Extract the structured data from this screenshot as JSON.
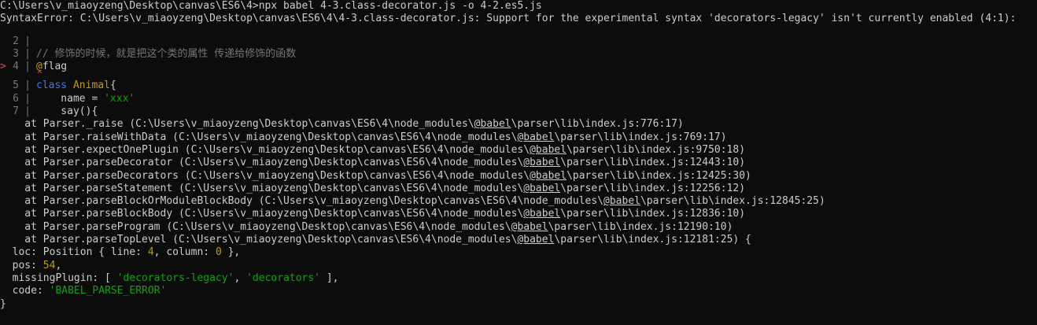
{
  "terminal": {
    "command_line": "C:\\Users\\v_miaoyzeng\\Desktop\\canvas\\ES6\\4>npx babel 4-3.class-decorator.js -o 4-2.es5.js",
    "error_line": "SyntaxError: C:\\Users\\v_miaoyzeng\\Desktop\\canvas\\ES6\\4\\4-3.class-decorator.js: Support for the experimental syntax 'decorators-legacy' isn't currently enabled (4:1):",
    "code_frame": [
      {
        "marker": "",
        "num": "2",
        "content": ""
      },
      {
        "marker": "",
        "num": "3",
        "content": "// 修饰的时候，就是把这个类的属性 传递给修饰的函数"
      },
      {
        "marker": ">",
        "num": "4",
        "content": "@flag"
      },
      {
        "marker": "",
        "num": "5",
        "content": "class Animal{"
      },
      {
        "marker": "",
        "num": "6",
        "content": "    name = 'xxx'"
      },
      {
        "marker": "",
        "num": "7",
        "content": "    say(){"
      }
    ],
    "caret_symbol": "^",
    "stack": [
      {
        "prefix": "    at Parser._raise (C:\\Users\\v_miaoyzeng\\Desktop\\canvas\\ES6\\4\\node_modules\\",
        "link": "@babel",
        "suffix": "\\parser\\lib\\index.js:776:17)"
      },
      {
        "prefix": "    at Parser.raiseWithData (C:\\Users\\v_miaoyzeng\\Desktop\\canvas\\ES6\\4\\node_modules\\",
        "link": "@babel",
        "suffix": "\\parser\\lib\\index.js:769:17)"
      },
      {
        "prefix": "    at Parser.expectOnePlugin (C:\\Users\\v_miaoyzeng\\Desktop\\canvas\\ES6\\4\\node_modules\\",
        "link": "@babel",
        "suffix": "\\parser\\lib\\index.js:9750:18)"
      },
      {
        "prefix": "    at Parser.parseDecorator (C:\\Users\\v_miaoyzeng\\Desktop\\canvas\\ES6\\4\\node_modules\\",
        "link": "@babel",
        "suffix": "\\parser\\lib\\index.js:12443:10)"
      },
      {
        "prefix": "    at Parser.parseDecorators (C:\\Users\\v_miaoyzeng\\Desktop\\canvas\\ES6\\4\\node_modules\\",
        "link": "@babel",
        "suffix": "\\parser\\lib\\index.js:12425:30)"
      },
      {
        "prefix": "    at Parser.parseStatement (C:\\Users\\v_miaoyzeng\\Desktop\\canvas\\ES6\\4\\node_modules\\",
        "link": "@babel",
        "suffix": "\\parser\\lib\\index.js:12256:12)"
      },
      {
        "prefix": "    at Parser.parseBlockOrModuleBlockBody (C:\\Users\\v_miaoyzeng\\Desktop\\canvas\\ES6\\4\\node_modules\\",
        "link": "@babel",
        "suffix": "\\parser\\lib\\index.js:12845:25)"
      },
      {
        "prefix": "    at Parser.parseBlockBody (C:\\Users\\v_miaoyzeng\\Desktop\\canvas\\ES6\\4\\node_modules\\",
        "link": "@babel",
        "suffix": "\\parser\\lib\\index.js:12836:10)"
      },
      {
        "prefix": "    at Parser.parseProgram (C:\\Users\\v_miaoyzeng\\Desktop\\canvas\\ES6\\4\\node_modules\\",
        "link": "@babel",
        "suffix": "\\parser\\lib\\index.js:12190:10)"
      },
      {
        "prefix": "    at Parser.parseTopLevel (C:\\Users\\v_miaoyzeng\\Desktop\\canvas\\ES6\\4\\node_modules\\",
        "link": "@babel",
        "suffix": "\\parser\\lib\\index.js:12181:25) {"
      }
    ],
    "loc_label": "  loc: Position { line: ",
    "loc_line": "4",
    "loc_mid": ", column: ",
    "loc_column": "0",
    "loc_end": " },",
    "pos_label": "  pos: ",
    "pos_value": "54",
    "pos_end": ",",
    "missing_label": "  missingPlugin: [ ",
    "missing_a": "'decorators-legacy'",
    "missing_sep": ", ",
    "missing_b": "'decorators'",
    "missing_end": " ],",
    "code_label": "  code: ",
    "code_value": "'BABEL_PARSE_ERROR'",
    "closing": "}"
  },
  "colors": {
    "background": "#0c0c0c",
    "text": "#cccccc",
    "string": "#13a10e",
    "number": "#c19c00",
    "keyword": "#3b78ff",
    "marker": "#e74856"
  }
}
